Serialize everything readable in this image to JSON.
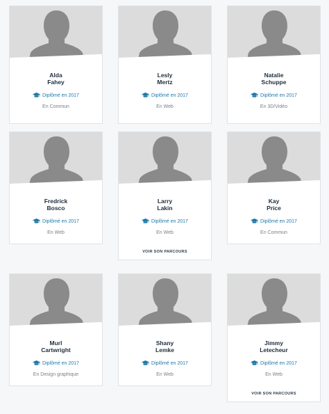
{
  "cards": [
    {
      "first": "Alda",
      "last": "Fahey",
      "grad": "Diplômé en 2017",
      "field": "En Commun",
      "link": ""
    },
    {
      "first": "Lesly",
      "last": "Mertz",
      "grad": "Diplômé en 2017",
      "field": "En Web",
      "link": ""
    },
    {
      "first": "Natalie",
      "last": "Schuppe",
      "grad": "Diplômé en 2017",
      "field": "En 3D/Vidéo",
      "link": ""
    },
    {
      "first": "Fredrick",
      "last": "Bosco",
      "grad": "Diplômé en 2017",
      "field": "En Web",
      "link": ""
    },
    {
      "first": "Larry",
      "last": "Lakin",
      "grad": "Diplômé en 2017",
      "field": "En Web",
      "link": "VOIR SON PARCOURS"
    },
    {
      "first": "Kay",
      "last": "Price",
      "grad": "Diplômé en 2017",
      "field": "En Commun",
      "link": ""
    },
    {
      "first": "Murl",
      "last": "Cartwright",
      "grad": "Diplômé en 2017",
      "field": "En Design graphique",
      "link": ""
    },
    {
      "first": "Shany",
      "last": "Lemke",
      "grad": "Diplômé en 2017",
      "field": "En Web",
      "link": ""
    },
    {
      "first": "Jimmy",
      "last": "Letecheur",
      "grad": "Diplômé en 2017",
      "field": "En Web",
      "link": "VOIR SON PARCOURS"
    }
  ],
  "colors": {
    "accent": "#1e78a8",
    "name": "#1f2d3d",
    "muted": "#7a7f85",
    "photo_bg": "#dcdcdc",
    "silhouette": "#8a8a8a"
  }
}
